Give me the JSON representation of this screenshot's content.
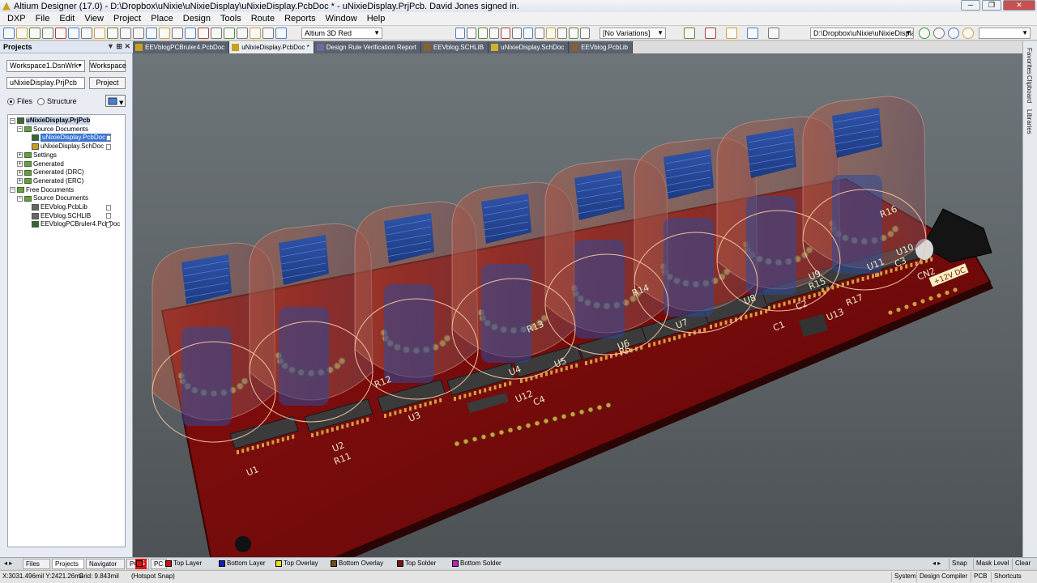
{
  "app": {
    "title": "Altium Designer (17.0) - D:\\Dropbox\\uNixie\\uNixieDisplay\\uNixieDisplay.PcbDoc * - uNixieDisplay.PrjPcb. David Jones signed in.",
    "window_buttons": [
      "─",
      "❐",
      "✕"
    ]
  },
  "menu": [
    "DXP",
    "File",
    "Edit",
    "View",
    "Project",
    "Place",
    "Design",
    "Tools",
    "Route",
    "Reports",
    "Window",
    "Help"
  ],
  "toolbar": {
    "view_config": "Altium 3D Red",
    "variations": "[No Variations]",
    "path": "D:\\Dropbox\\uNixie\\uNixieDisplay\\u"
  },
  "panel": {
    "title": "Projects",
    "workspace_combo": "Workspace1.DsnWrk",
    "workspace_button": "Workspace",
    "project_field": "uNixieDisplay.PrjPcb",
    "project_button": "Project",
    "radio_files": "Files",
    "radio_structure": "Structure"
  },
  "tree": [
    {
      "label": "uNixieDisplay.PrjPcb",
      "level": 0,
      "toggle": "−",
      "icon": "project",
      "selected": false,
      "bold": true
    },
    {
      "label": "Source Documents",
      "level": 1,
      "toggle": "−",
      "icon": "folder"
    },
    {
      "label": "uNixieDisplay.PcbDoc *",
      "level": 2,
      "toggle": "",
      "icon": "pcb",
      "selected": true
    },
    {
      "label": "uNixieDisplay.SchDoc",
      "level": 2,
      "toggle": "",
      "icon": "sch"
    },
    {
      "label": "Settings",
      "level": 1,
      "toggle": "+",
      "icon": "folder"
    },
    {
      "label": "Generated",
      "level": 1,
      "toggle": "+",
      "icon": "folder"
    },
    {
      "label": "Generated (DRC)",
      "level": 1,
      "toggle": "+",
      "icon": "folder"
    },
    {
      "label": "Generated (ERC)",
      "level": 1,
      "toggle": "+",
      "icon": "folder"
    },
    {
      "label": "Free Documents",
      "level": 0,
      "toggle": "−",
      "icon": "folder"
    },
    {
      "label": "Source Documents",
      "level": 1,
      "toggle": "−",
      "icon": "folder"
    },
    {
      "label": "EEVblog.PcbLib",
      "level": 2,
      "toggle": "",
      "icon": "lib"
    },
    {
      "label": "EEVblog.SCHLIB",
      "level": 2,
      "toggle": "",
      "icon": "lib"
    },
    {
      "label": "EEVblogPCBruler4.PcbDoc",
      "level": 2,
      "toggle": "",
      "icon": "pcb"
    }
  ],
  "doc_tabs": [
    {
      "label": "EEVblogPCBruler4.PcbDoc",
      "active": false
    },
    {
      "label": "uNixieDisplay.PcbDoc *",
      "active": true
    },
    {
      "label": "Design Rule Verification Report",
      "active": false
    },
    {
      "label": "EEVblog.SCHLIB",
      "active": false
    },
    {
      "label": "uNixieDisplay.SchDoc",
      "active": false
    },
    {
      "label": "EEVblog.PcbLib",
      "active": false
    }
  ],
  "right_panels": [
    "Favorites",
    "Clipboard",
    "Libraries"
  ],
  "pcb": {
    "silk_labels": [
      "U1",
      "U2",
      "R11",
      "U3",
      "R12",
      "U4",
      "U5",
      "R13",
      "U12",
      "C4",
      "U6",
      "R5",
      "U7",
      "R14",
      "U8",
      "U9",
      "R15",
      "C1",
      "C2",
      "U13",
      "R17",
      "U11",
      "U10",
      "R16",
      "C3",
      "CN2",
      "+12V DC"
    ]
  },
  "bottom_tabs": [
    "Files",
    "Projects",
    "Navigator",
    "PCB",
    "PC"
  ],
  "layers": [
    {
      "label": "LS",
      "color": "#e01010"
    },
    {
      "label": "Top Layer",
      "color": "#d01010"
    },
    {
      "label": "Bottom Layer",
      "color": "#1020c0"
    },
    {
      "label": "Top Overlay",
      "color": "#f0e010"
    },
    {
      "label": "Bottom Overlay",
      "color": "#705010"
    },
    {
      "label": "Top Solder",
      "color": "#801010"
    },
    {
      "label": "Bottom Solder",
      "color": "#c020c0"
    }
  ],
  "right_controls": [
    "Snap",
    "Mask Level",
    "Clear"
  ],
  "status": {
    "coords": "X:3031.496mil Y:2421.26mil",
    "grid": "Grid: 9.843mil",
    "snap": "(Hotspot Snap)",
    "buttons": [
      "System",
      "Design Compiler",
      "PCB",
      "Shortcuts"
    ]
  }
}
